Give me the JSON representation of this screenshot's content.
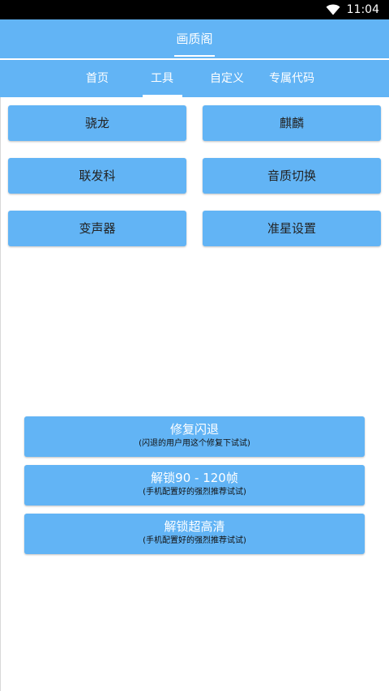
{
  "status": {
    "time": "11:04"
  },
  "app": {
    "title": "画质阁"
  },
  "tabs": [
    {
      "label": "首页",
      "active": false
    },
    {
      "label": "工具",
      "active": true
    },
    {
      "label": "自定义",
      "active": false
    },
    {
      "label": "专属代码",
      "active": false
    }
  ],
  "grid_buttons": [
    {
      "label": "骁龙"
    },
    {
      "label": "麒麟"
    },
    {
      "label": "联发科"
    },
    {
      "label": "音质切换"
    },
    {
      "label": "变声器"
    },
    {
      "label": "准星设置"
    }
  ],
  "actions": [
    {
      "label": "修复闪退",
      "sub": "(闪退的用户用这个修复下试试)"
    },
    {
      "label": "解锁90 - 120帧",
      "sub": "(手机配置好的强烈推荐试试)"
    },
    {
      "label": "解锁超高清",
      "sub": "(手机配置好的强烈推荐试试)"
    }
  ],
  "colors": {
    "primary": "#62b4f5",
    "statusbar": "#000000"
  },
  "icons": [
    "wifi-icon"
  ]
}
